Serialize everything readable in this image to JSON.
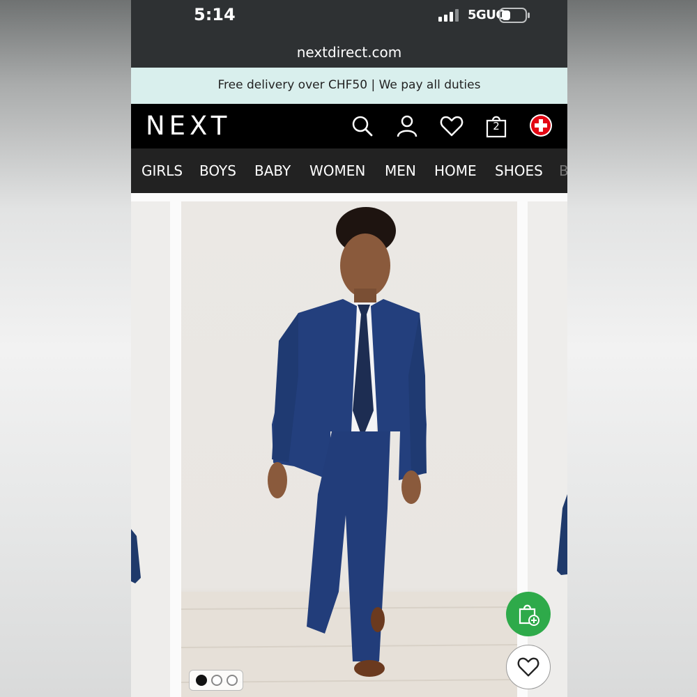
{
  "status_bar": {
    "time": "5:14",
    "network": "5GUC",
    "icons": [
      "signal-icon",
      "battery-icon"
    ]
  },
  "browser": {
    "url": "nextdirect.com"
  },
  "promo": {
    "text": "Free delivery over CHF50 | We pay all duties"
  },
  "header": {
    "logo": "NEXT",
    "cart_count": "2",
    "icons": [
      "search-icon",
      "account-icon",
      "favourites-icon",
      "bag-icon",
      "swiss-flag-icon"
    ]
  },
  "nav": {
    "items": [
      "GIRLS",
      "BOYS",
      "BABY",
      "WOMEN",
      "MEN",
      "HOME",
      "SHOES",
      "B"
    ]
  },
  "gallery": {
    "total_images": 3,
    "active_index": 0
  },
  "actions": {
    "icons": [
      "add-to-bag-icon",
      "heart-icon"
    ]
  },
  "colors": {
    "status_bg": "#2e3133",
    "promo_bg": "#d9efed",
    "header_bg": "#000000",
    "nav_bg": "#222222",
    "accent_green": "#2eaa4a",
    "swiss_red": "#e30613"
  }
}
